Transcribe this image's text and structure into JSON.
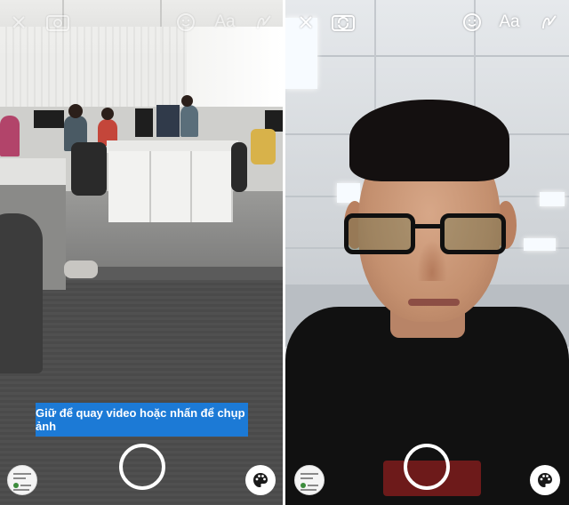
{
  "left_screen": {
    "top_bar": {
      "close_icon": "close-icon",
      "flip_camera_icon": "flip-camera-icon",
      "emoji_icon": "emoji-icon",
      "text_tool_label": "Aa",
      "draw_icon": "draw-icon"
    },
    "capture_hint": "Giữ để quay video hoặc nhấn để chụp ảnh",
    "gallery_icon": "gallery-thumbnail",
    "shutter_icon": "shutter-button",
    "palette_icon": "palette-icon"
  },
  "right_screen": {
    "top_bar": {
      "close_icon": "close-icon",
      "flip_camera_icon": "flip-camera-icon",
      "emoji_icon": "emoji-icon",
      "text_tool_label": "Aa",
      "draw_icon": "draw-icon"
    },
    "gallery_icon": "gallery-thumbnail",
    "shutter_icon": "shutter-button",
    "palette_icon": "palette-icon"
  },
  "colors": {
    "hint_background": "#1c7ad6",
    "control_foreground": "#ffffff",
    "palette_button_background": "#ffffff"
  }
}
